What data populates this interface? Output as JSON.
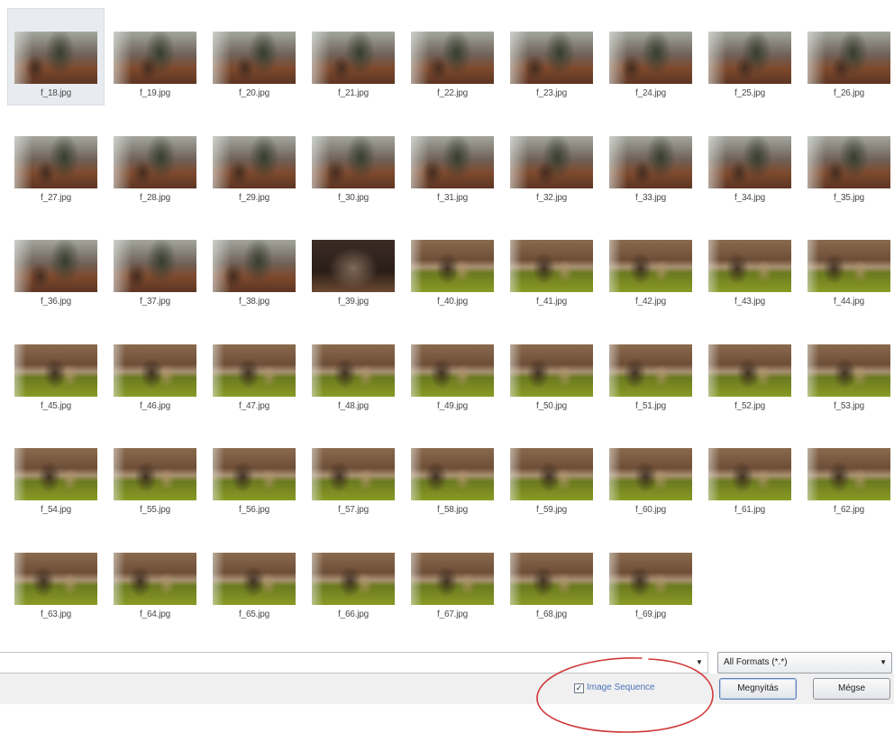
{
  "files": [
    {
      "name": "f_18.jpg",
      "scene": "living",
      "selected": true
    },
    {
      "name": "f_19.jpg",
      "scene": "living"
    },
    {
      "name": "f_20.jpg",
      "scene": "living"
    },
    {
      "name": "f_21.jpg",
      "scene": "living"
    },
    {
      "name": "f_22.jpg",
      "scene": "living"
    },
    {
      "name": "f_23.jpg",
      "scene": "living"
    },
    {
      "name": "f_24.jpg",
      "scene": "living"
    },
    {
      "name": "f_25.jpg",
      "scene": "living"
    },
    {
      "name": "f_26.jpg",
      "scene": "living"
    },
    {
      "name": "f_27.jpg",
      "scene": "living"
    },
    {
      "name": "f_28.jpg",
      "scene": "living"
    },
    {
      "name": "f_29.jpg",
      "scene": "living"
    },
    {
      "name": "f_30.jpg",
      "scene": "living"
    },
    {
      "name": "f_31.jpg",
      "scene": "living"
    },
    {
      "name": "f_32.jpg",
      "scene": "living"
    },
    {
      "name": "f_33.jpg",
      "scene": "living"
    },
    {
      "name": "f_34.jpg",
      "scene": "living"
    },
    {
      "name": "f_35.jpg",
      "scene": "living"
    },
    {
      "name": "f_36.jpg",
      "scene": "living"
    },
    {
      "name": "f_37.jpg",
      "scene": "living"
    },
    {
      "name": "f_38.jpg",
      "scene": "living"
    },
    {
      "name": "f_39.jpg",
      "scene": "living-dark"
    },
    {
      "name": "f_40.jpg",
      "scene": "grass"
    },
    {
      "name": "f_41.jpg",
      "scene": "grass"
    },
    {
      "name": "f_42.jpg",
      "scene": "grass"
    },
    {
      "name": "f_43.jpg",
      "scene": "grass"
    },
    {
      "name": "f_44.jpg",
      "scene": "grass"
    },
    {
      "name": "f_45.jpg",
      "scene": "grass"
    },
    {
      "name": "f_46.jpg",
      "scene": "grass"
    },
    {
      "name": "f_47.jpg",
      "scene": "grass"
    },
    {
      "name": "f_48.jpg",
      "scene": "grass"
    },
    {
      "name": "f_49.jpg",
      "scene": "grass"
    },
    {
      "name": "f_50.jpg",
      "scene": "grass"
    },
    {
      "name": "f_51.jpg",
      "scene": "grass"
    },
    {
      "name": "f_52.jpg",
      "scene": "grass"
    },
    {
      "name": "f_53.jpg",
      "scene": "grass"
    },
    {
      "name": "f_54.jpg",
      "scene": "grass"
    },
    {
      "name": "f_55.jpg",
      "scene": "grass"
    },
    {
      "name": "f_56.jpg",
      "scene": "grass"
    },
    {
      "name": "f_57.jpg",
      "scene": "grass"
    },
    {
      "name": "f_58.jpg",
      "scene": "grass"
    },
    {
      "name": "f_59.jpg",
      "scene": "grass"
    },
    {
      "name": "f_60.jpg",
      "scene": "grass"
    },
    {
      "name": "f_61.jpg",
      "scene": "grass"
    },
    {
      "name": "f_62.jpg",
      "scene": "grass"
    },
    {
      "name": "f_63.jpg",
      "scene": "grass"
    },
    {
      "name": "f_64.jpg",
      "scene": "grass"
    },
    {
      "name": "f_65.jpg",
      "scene": "grass"
    },
    {
      "name": "f_66.jpg",
      "scene": "grass"
    },
    {
      "name": "f_67.jpg",
      "scene": "grass"
    },
    {
      "name": "f_68.jpg",
      "scene": "grass"
    },
    {
      "name": "f_69.jpg",
      "scene": "grass"
    }
  ],
  "filename_field": {
    "value": "",
    "dropdown_icon": "chevron-down-icon"
  },
  "format_select": {
    "selected": "All Formats (*.*)",
    "icon": "chevron-down-icon"
  },
  "image_sequence": {
    "label": "Image Sequence",
    "checked": true,
    "check_glyph": "✓"
  },
  "buttons": {
    "open_label": "Megnyitás",
    "cancel_label": "Mégse"
  },
  "colors": {
    "annotation": "#d03a3a",
    "link_label": "#4a73b8",
    "selection": "#e8ecf1"
  }
}
